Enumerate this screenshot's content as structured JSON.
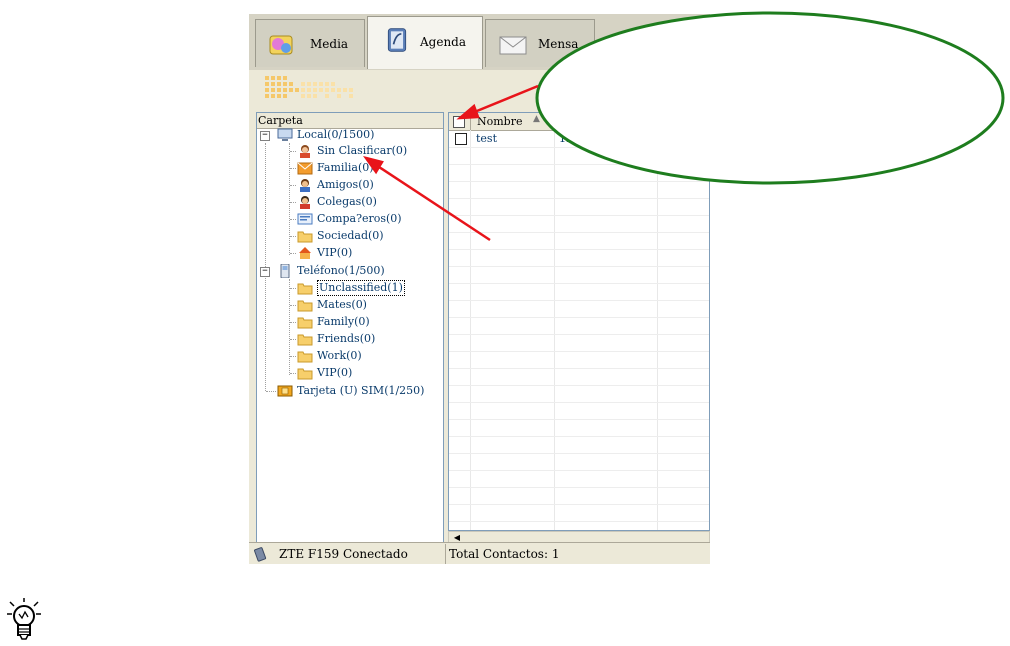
{
  "tabs": [
    {
      "label": "Media",
      "icon": "media-icon"
    },
    {
      "label": "Agenda",
      "icon": "address-book-icon"
    },
    {
      "label": "Mensa",
      "icon": "envelope-icon"
    }
  ],
  "tree": {
    "header": "Carpeta",
    "groups": [
      {
        "label": "Local(0/1500)",
        "icon": "computer-icon",
        "children": [
          "Sin Clasificar(0)",
          "Familia(0)",
          "Amigos(0)",
          "Colegas(0)",
          "Compa?eros(0)",
          "Sociedad(0)",
          "VIP(0)"
        ]
      },
      {
        "label": "Teléfono(1/500)",
        "icon": "phone-icon",
        "children": [
          "Unclassified(1)",
          "Mates(0)",
          "Family(0)",
          "Friends(0)",
          "Work(0)",
          "VIP(0)"
        ]
      },
      {
        "label": "Tarjeta (U) SIM(1/250)",
        "icon": "sim-card-icon",
        "children": []
      }
    ]
  },
  "grid": {
    "columns": [
      "Nombre"
    ],
    "rows": [
      {
        "name": "test",
        "number": "12"
      }
    ]
  },
  "status": {
    "device": "ZTE F159 Conectado",
    "total": "Total Contactos: 1"
  },
  "annotation": {
    "ellipse_color": "#1e7d1e",
    "arrow_color": "#e8141a",
    "hint_icon": "lightbulb-icon"
  }
}
